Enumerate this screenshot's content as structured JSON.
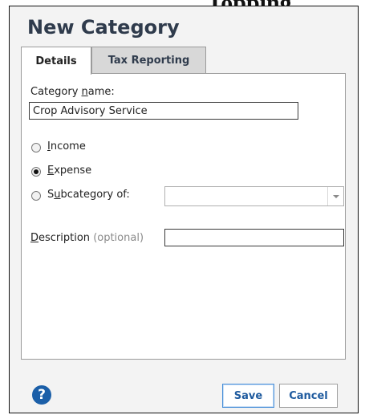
{
  "header_fragment": "Topping",
  "dialog": {
    "title": "New Category",
    "tabs": [
      {
        "label": "Details",
        "active": true
      },
      {
        "label": "Tax Reporting",
        "active": false
      }
    ],
    "category_name": {
      "label_before": "Category ",
      "label_underlined": "n",
      "label_after": "ame:",
      "value": "Crop Advisory Service"
    },
    "radios": [
      {
        "underlined": "I",
        "rest": "ncome",
        "checked": false
      },
      {
        "underlined": "E",
        "rest": "xpense",
        "checked": true
      },
      {
        "before": "S",
        "underlined": "u",
        "rest": "bcategory of:",
        "checked": false
      }
    ],
    "subcategory_select": {
      "value": ""
    },
    "description": {
      "label_underlined": "D",
      "label_rest": "escription",
      "optional": "(optional)",
      "value": ""
    },
    "buttons": {
      "help": "?",
      "save": "Save",
      "cancel": "Cancel"
    }
  },
  "colors": {
    "title": "#2f3b4c",
    "button_text": "#1e5a9e",
    "help_icon": "#1b5fa8"
  }
}
